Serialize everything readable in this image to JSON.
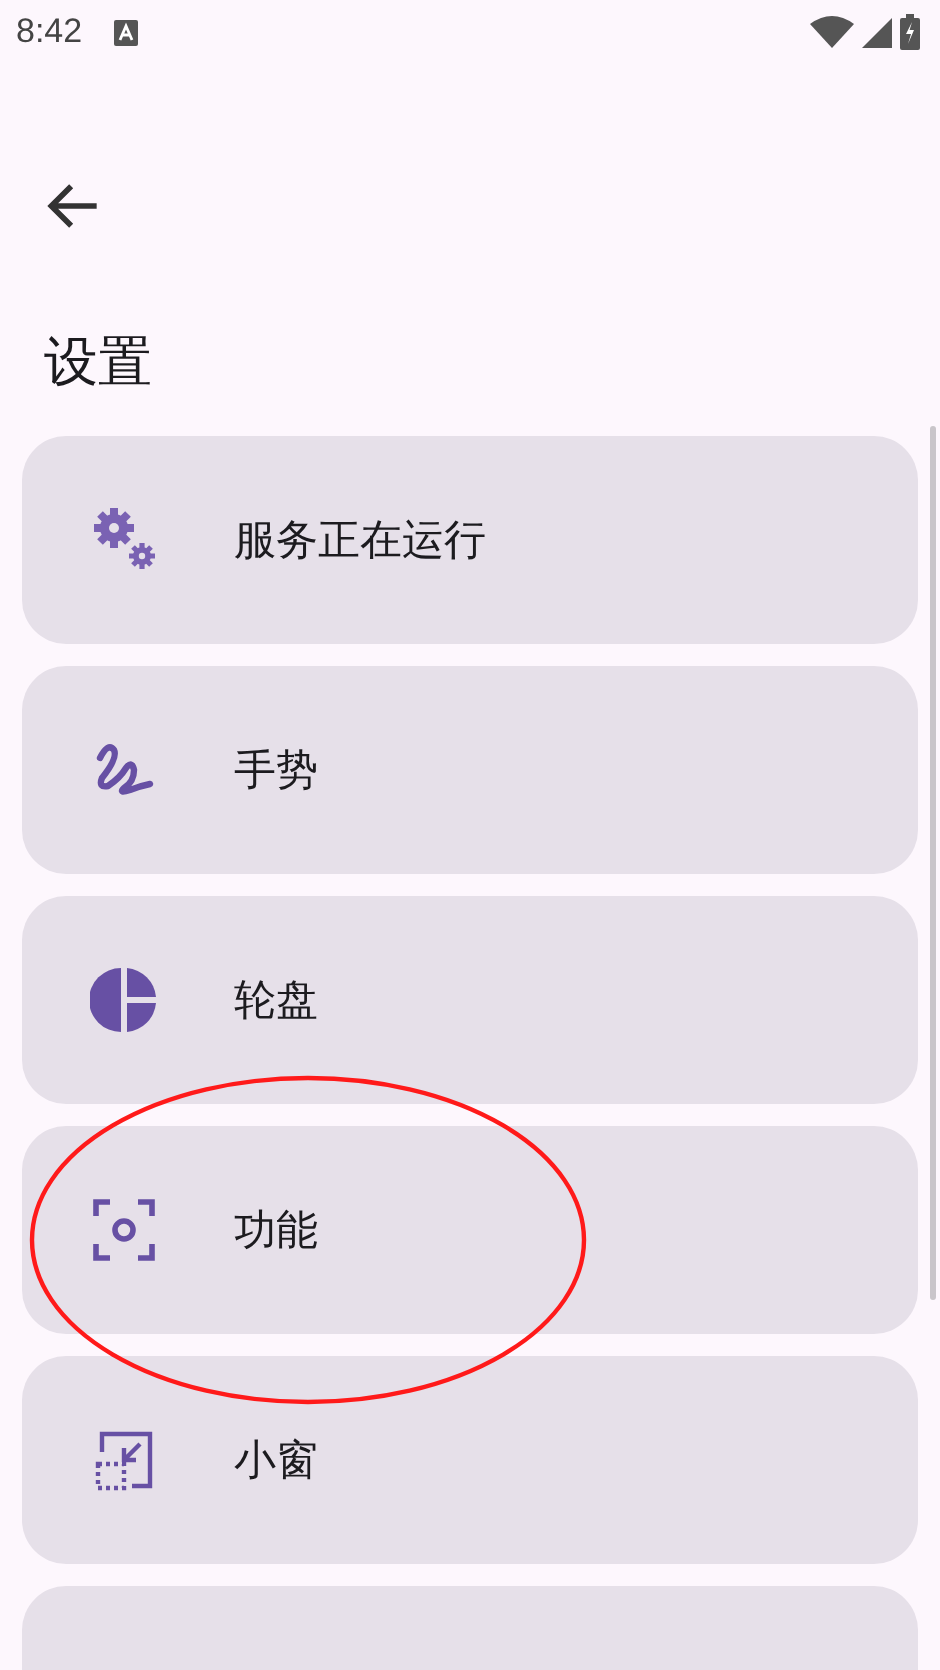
{
  "status_bar": {
    "time": "8:42"
  },
  "title": "设置",
  "items": [
    {
      "kind": "gears",
      "label": "服务正在运行"
    },
    {
      "kind": "gesture",
      "label": "手势"
    },
    {
      "kind": "pie",
      "label": "轮盘"
    },
    {
      "kind": "focus",
      "label": "功能"
    },
    {
      "kind": "pip",
      "label": "小窗"
    }
  ],
  "annotation": {
    "kind": "ellipse",
    "color": "#ff1a1a"
  }
}
